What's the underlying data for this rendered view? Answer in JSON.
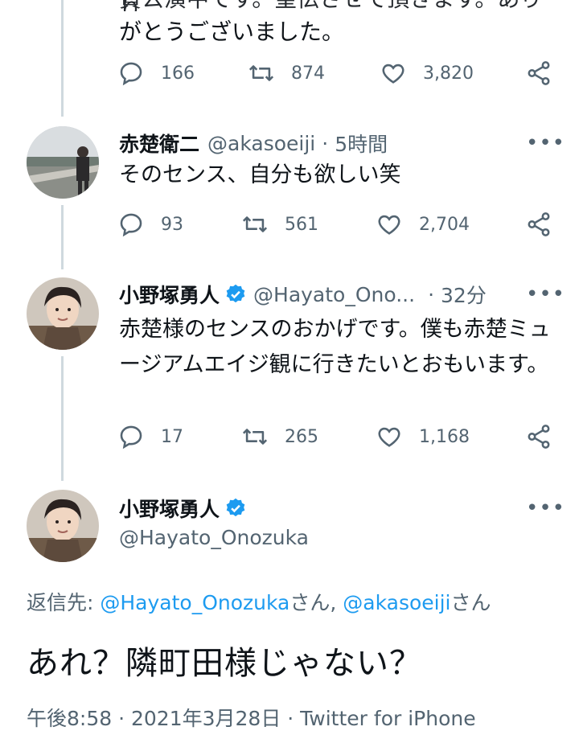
{
  "top_tweet": {
    "partial_line_1": "貴公演中です。皇伝させて頂きます。ありり",
    "partial_line_2": "がとうございました。",
    "replies": "166",
    "retweets": "874",
    "likes": "3,820"
  },
  "tweet2": {
    "name": "赤楚衛二",
    "handle": "@akasoeiji",
    "sep": "·",
    "time": "5時間",
    "text": "そのセンス、自分も欲しい笑",
    "replies": "93",
    "retweets": "561",
    "likes": "2,704"
  },
  "tweet3": {
    "name": "小野塚勇人",
    "handle": "@Hayato_Ono...",
    "sep": "·",
    "time": "32分",
    "text": "赤楚様のセンスのおかげです。僕も赤楚ミュージアムエイジ観に行きたいとおもいます。",
    "replies": "17",
    "retweets": "265",
    "likes": "1,168"
  },
  "main_tweet": {
    "name": "小野塚勇人",
    "handle": "@Hayato_Onozuka",
    "reply_prefix": "返信先: ",
    "reply_user1": "@Hayato_Onozuka",
    "reply_suffix1": "さん, ",
    "reply_user2": "@akasoeiji",
    "reply_suffix2": "さん",
    "text": "あれ？隣町田様じゃない？",
    "meta": "午後8:58 · 2021年3月28日 · Twitter for iPhone"
  },
  "more_label": "•••",
  "colors": {
    "accent": "#1d9bf0",
    "muted": "#536471",
    "thread": "#cfd9de"
  }
}
